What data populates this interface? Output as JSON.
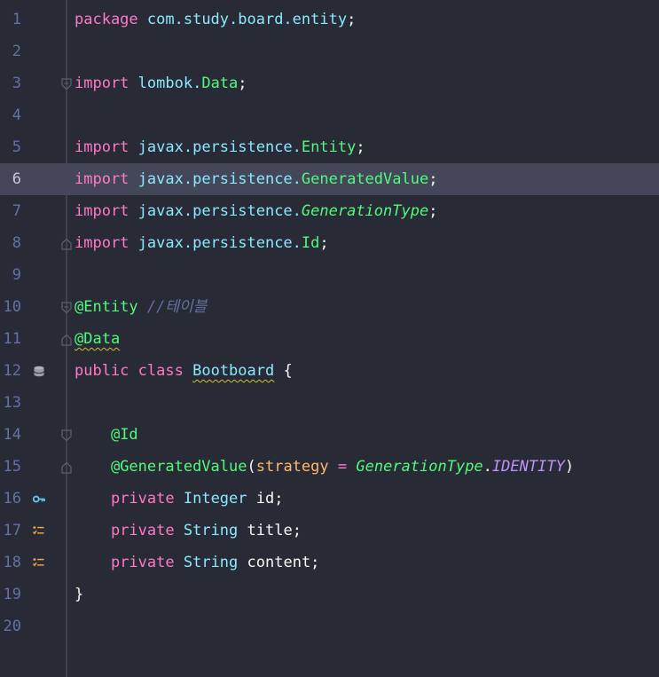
{
  "editor": {
    "current_line": 6,
    "lines": [
      {
        "n": "1",
        "t": {
          "kw": "package",
          "pkg": "com.study.board.entity",
          "semi": ";"
        }
      },
      {
        "n": "2"
      },
      {
        "n": "3",
        "t": {
          "kw": "import",
          "pkg": "lombok.",
          "cls": "Data",
          "semi": ";"
        }
      },
      {
        "n": "4"
      },
      {
        "n": "5",
        "t": {
          "kw": "import",
          "pkg": "javax.persistence.",
          "cls": "Entity",
          "semi": ";"
        }
      },
      {
        "n": "6",
        "t": {
          "kw": "import",
          "pkg": "javax.persistence.",
          "cls": "GeneratedValue",
          "semi": ";"
        }
      },
      {
        "n": "7",
        "t": {
          "kw": "import",
          "pkg": "javax.persistence.",
          "cls": "GenerationType",
          "semi": ";"
        }
      },
      {
        "n": "8",
        "t": {
          "kw": "import",
          "pkg": "javax.persistence.",
          "cls": "Id",
          "semi": ";"
        }
      },
      {
        "n": "9"
      },
      {
        "n": "10",
        "t": {
          "ann": "@Entity",
          "comment": "//테이블"
        }
      },
      {
        "n": "11",
        "t": {
          "ann": "@Data"
        }
      },
      {
        "n": "12",
        "t": {
          "kw1": "public",
          "kw2": "class",
          "cls": "Bootboard",
          "brace": "{"
        }
      },
      {
        "n": "13"
      },
      {
        "n": "14",
        "t": {
          "ann": "@Id"
        }
      },
      {
        "n": "15",
        "t": {
          "ann": "@GeneratedValue",
          "open": "(",
          "param": "strategy",
          "eq": "=",
          "type": "GenerationType",
          "dot": ".",
          "const": "IDENTITY",
          "close": ")"
        }
      },
      {
        "n": "16",
        "t": {
          "kw": "private",
          "type": "Integer",
          "name": "id;"
        }
      },
      {
        "n": "17",
        "t": {
          "kw": "private",
          "type": "String",
          "name": "title;"
        }
      },
      {
        "n": "18",
        "t": {
          "kw": "private",
          "type": "String",
          "name": "content;"
        }
      },
      {
        "n": "19",
        "t": {
          "brace": "}"
        }
      },
      {
        "n": "20"
      }
    ]
  },
  "colors": {
    "background": "#282a36",
    "current_line": "#44475a",
    "keyword": "#ff79c6",
    "annotation": "#50fa7b",
    "type": "#8be9fd",
    "comment": "#6272a4",
    "constant": "#bd93f9",
    "parameter": "#ffb86c"
  },
  "gutter_icons": {
    "12": "database-entity-icon",
    "16": "primary-key-icon",
    "17": "column-field-icon",
    "18": "column-field-icon"
  }
}
